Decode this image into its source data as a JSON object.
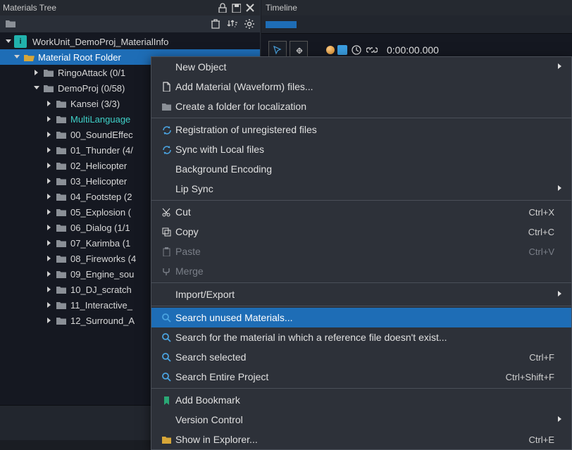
{
  "panels": {
    "tree_title": "Materials Tree",
    "timeline_title": "Timeline"
  },
  "timeline": {
    "timecode": "0:00:00.000"
  },
  "tree": {
    "workunit": "WorkUnit_DemoProj_MaterialInfo",
    "root": "Material Root Folder",
    "items": [
      {
        "label": "RingoAttack (0/1",
        "depth": 2,
        "exp": "right",
        "color": "gray"
      },
      {
        "label": "DemoProj (0/58)",
        "depth": 2,
        "exp": "down",
        "color": "gray"
      },
      {
        "label": "Kansei (3/3)",
        "depth": 3,
        "exp": "right",
        "color": "gray"
      },
      {
        "label": "MultiLanguage",
        "depth": 3,
        "exp": "right",
        "color": "gray",
        "teal": true
      },
      {
        "label": "00_SoundEffec",
        "depth": 3,
        "exp": "right",
        "color": "gray"
      },
      {
        "label": "01_Thunder (4/",
        "depth": 3,
        "exp": "right",
        "color": "gray"
      },
      {
        "label": "02_Helicopter",
        "depth": 3,
        "exp": "right",
        "color": "gray"
      },
      {
        "label": "03_Helicopter",
        "depth": 3,
        "exp": "right",
        "color": "gray"
      },
      {
        "label": "04_Footstep (2",
        "depth": 3,
        "exp": "right",
        "color": "gray"
      },
      {
        "label": "05_Explosion (",
        "depth": 3,
        "exp": "right",
        "color": "gray"
      },
      {
        "label": "06_Dialog (1/1",
        "depth": 3,
        "exp": "right",
        "color": "gray"
      },
      {
        "label": "07_Karimba (1",
        "depth": 3,
        "exp": "right",
        "color": "gray"
      },
      {
        "label": "08_Fireworks (4",
        "depth": 3,
        "exp": "right",
        "color": "gray"
      },
      {
        "label": "09_Engine_sou",
        "depth": 3,
        "exp": "right",
        "color": "gray"
      },
      {
        "label": "10_DJ_scratch",
        "depth": 3,
        "exp": "right",
        "color": "gray"
      },
      {
        "label": "11_Interactive_",
        "depth": 3,
        "exp": "right",
        "color": "gray"
      },
      {
        "label": "12_Surround_A",
        "depth": 3,
        "exp": "right",
        "color": "gray"
      }
    ]
  },
  "menu": [
    {
      "type": "item",
      "label": "New Object",
      "sub": true
    },
    {
      "type": "item",
      "icon": "file",
      "label": "Add Material (Waveform) files..."
    },
    {
      "type": "item",
      "icon": "folder",
      "label": "Create a folder for localization"
    },
    {
      "type": "sep"
    },
    {
      "type": "item",
      "icon": "refresh",
      "label": "Registration of unregistered files"
    },
    {
      "type": "item",
      "icon": "refresh",
      "label": "Sync with Local files"
    },
    {
      "type": "item",
      "label": "Background Encoding"
    },
    {
      "type": "item",
      "label": "Lip Sync",
      "sub": true
    },
    {
      "type": "sep"
    },
    {
      "type": "item",
      "icon": "cut",
      "label": "Cut",
      "accel": "Ctrl+X"
    },
    {
      "type": "item",
      "icon": "copy",
      "label": "Copy",
      "accel": "Ctrl+C"
    },
    {
      "type": "item",
      "icon": "paste",
      "label": "Paste",
      "accel": "Ctrl+V",
      "disabled": true
    },
    {
      "type": "item",
      "icon": "merge",
      "label": "Merge",
      "disabled": true
    },
    {
      "type": "sep"
    },
    {
      "type": "item",
      "label": "Import/Export",
      "sub": true
    },
    {
      "type": "sep"
    },
    {
      "type": "item",
      "icon": "search",
      "label": "Search unused Materials...",
      "highlight": true
    },
    {
      "type": "item",
      "icon": "search",
      "label": "Search for the material in which a reference file doesn't exist..."
    },
    {
      "type": "item",
      "icon": "search",
      "label": "Search selected",
      "accel": "Ctrl+F"
    },
    {
      "type": "item",
      "icon": "search",
      "label": "Search Entire Project",
      "accel": "Ctrl+Shift+F"
    },
    {
      "type": "sep"
    },
    {
      "type": "item",
      "icon": "bookmark",
      "label": "Add Bookmark"
    },
    {
      "type": "item",
      "label": "Version Control",
      "sub": true
    },
    {
      "type": "item",
      "icon": "folder-y",
      "label": "Show in Explorer...",
      "accel": "Ctrl+E"
    }
  ]
}
